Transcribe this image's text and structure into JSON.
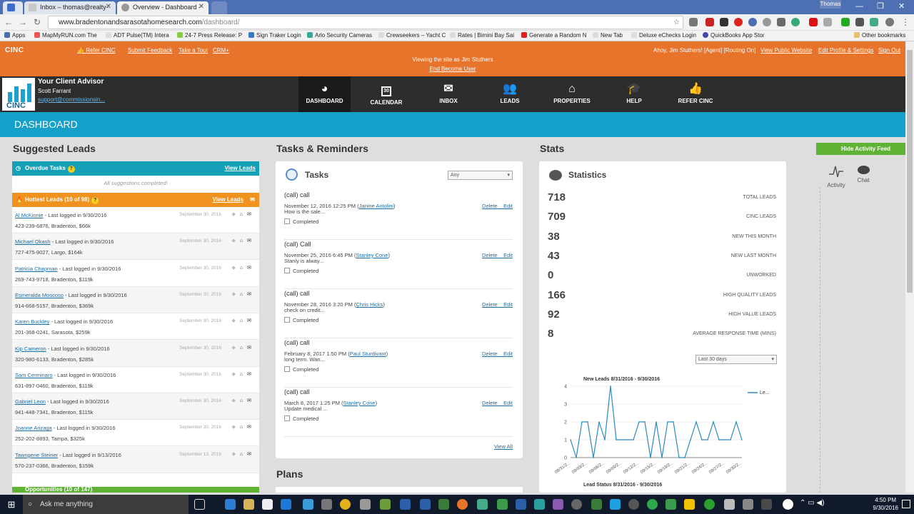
{
  "browser": {
    "tabs": [
      {
        "label": ""
      },
      {
        "label": "Inbox – thomas@realty-"
      },
      {
        "label": "Overview - Dashboard -"
      }
    ],
    "user": "Thomas",
    "url_main": "www.bradentonandsarasotahomesearch.com",
    "url_path": "/dashboard/",
    "bookmarks": [
      "Apps",
      "MapMyRUN.com The",
      "ADT Pulse(TM) Intera",
      "24-7 Press Release: P",
      "Sign Traker Login",
      "Arlo Security Cameras",
      "Crewseekers – Yacht C",
      "Rates | Bimini Bay Sai",
      "Generate a Random N",
      "New Tab",
      "Deluxe eChecks Login",
      "QuickBooks App Stor",
      "Other bookmarks"
    ]
  },
  "topbar": {
    "logo": "CINC",
    "links": [
      "Refer CINC",
      "Submit Feedback",
      "Take a Tour",
      "CRM+"
    ],
    "viewing": "Viewing the site as Jim Stuthers",
    "end_user": "End Become User",
    "greeting": "Ahoy, Jim Stuthers! [Agent] [Routing On]",
    "right_links": [
      "View Public Website",
      "Edit Profile & Settings",
      "Sign Out"
    ]
  },
  "advisor": {
    "title": "Your Client Advisor",
    "name": "Scott Farrant",
    "email": "support@commissionsin...",
    "logo_text": "CINC"
  },
  "nav": [
    {
      "label": "DASHBOARD",
      "icon": "dashboard-icon"
    },
    {
      "label": "CALENDAR",
      "icon": "calendar-icon",
      "day": "30"
    },
    {
      "label": "INBOX",
      "icon": "envelope-icon"
    },
    {
      "label": "LEADS",
      "icon": "users-icon"
    },
    {
      "label": "PROPERTIES",
      "icon": "home-icon"
    },
    {
      "label": "HELP",
      "icon": "graduation-cap-icon"
    },
    {
      "label": "REFER CINC",
      "icon": "thumbs-up-icon"
    }
  ],
  "page_title": "DASHBOARD",
  "suggested": {
    "title": "Suggested Leads",
    "overdue": "Overdue Tasks",
    "view_leads": "View Leads",
    "all_done": "All suggestions completed!",
    "hottest": "Hottest Leads (10 of 98)",
    "leads": [
      {
        "name": "Al McKinnie",
        "status": " - Last logged in 9/30/2016",
        "info": "423-239-6876, Bradenton, $66k",
        "date": "September 30, 2016"
      },
      {
        "name": "Michael Okash",
        "status": " - Last logged in 9/30/2016",
        "info": "727-475-9027, Largo, $164k",
        "date": "September 30, 2016"
      },
      {
        "name": "Patricia Chapman",
        "status": " - Last logged in 9/30/2016",
        "info": "269-743-9718, Bradenton, $119k",
        "date": "September 30, 2016"
      },
      {
        "name": "Esmeralda Moscoso",
        "status": " - Last logged in 9/30/2016",
        "info": "914-668-5157, Bradenton, $369k",
        "date": "September 30, 2016"
      },
      {
        "name": "Karen Buckley",
        "status": " - Last logged in 9/30/2016",
        "info": "201-368-0241, Sarasota, $259k",
        "date": "September 30, 2016"
      },
      {
        "name": "Kip Cameron",
        "status": " - Last logged in 9/30/2016",
        "info": "320-980-6133, Bradenton, $285k",
        "date": "September 30, 2016"
      },
      {
        "name": "Sam Cerminaro",
        "status": " - Last logged in 9/30/2016",
        "info": "631-897-0460, Bradenton, $119k",
        "date": "September 30, 2016"
      },
      {
        "name": "Gabriel Leon",
        "status": " - Last logged in 9/30/2016",
        "info": "941-448-7341, Bradenton, $115k",
        "date": "September 30, 2016"
      },
      {
        "name": "Joanne Arizaga",
        "status": " - Last logged in 9/30/2016",
        "info": "252-202-8893, Tampa, $325k",
        "date": "September 30, 2016"
      },
      {
        "name": "Tawngene Steiner",
        "status": " - Last logged in 9/13/2016",
        "info": "570-237-0366, Bradenton, $159k",
        "date": "September 13, 2016"
      }
    ],
    "opportunities": "Opportunities (10 of 147)"
  },
  "tasks": {
    "title": "Tasks & Reminders",
    "panel_title": "Tasks",
    "filter": "Any",
    "delete": "Delete",
    "edit": "Edit",
    "completed": "Completed",
    "items": [
      {
        "title": "(call) call",
        "when": "November 12, 2016 12:25 PM (",
        "who": "Janine Antolini",
        "note": "How is the sale..."
      },
      {
        "title": "(call) Call",
        "when": "November 25, 2016 6:45 PM (",
        "who": "Stanley Cone",
        "note": "Stanly is alway..."
      },
      {
        "title": "(call) call",
        "when": "November 28, 2016 3:20 PM (",
        "who": "Chris Hicks",
        "note": "check on credit..."
      },
      {
        "title": "(call) call",
        "when": "February 8, 2017 1:50 PM (",
        "who": "Paul Sturdivant",
        "note": "long term. Wan..."
      },
      {
        "title": "(call) call",
        "when": "March 8, 2017 1:25 PM (",
        "who": "Stanley Cone",
        "note": "Update medical ..."
      }
    ],
    "view_all": "View All",
    "plans": "Plans"
  },
  "stats": {
    "title": "Stats",
    "panel_title": "Statistics",
    "rows": [
      {
        "value": "718",
        "label": "TOTAL LEADS"
      },
      {
        "value": "709",
        "label": "CINC LEADS"
      },
      {
        "value": "38",
        "label": "NEW THIS MONTH"
      },
      {
        "value": "43",
        "label": "NEW LAST MONTH"
      },
      {
        "value": "0",
        "label": "UNWORKED"
      },
      {
        "value": "166",
        "label": "HIGH QUALITY LEADS"
      },
      {
        "value": "92",
        "label": "HIGH VALUE LEADS"
      },
      {
        "value": "8",
        "label": "AVERAGE RESPONSE TIME (MINS)"
      }
    ],
    "range": "Last 30 days",
    "lead_status": "Lead Status 8/31/2016 - 9/30/2016"
  },
  "chart_data": {
    "type": "line",
    "title": "New Leads 8/31/2016 - 9/30/2016",
    "legend": [
      "Le..."
    ],
    "legend_position": "top-right",
    "ylim": [
      0,
      4
    ],
    "yticks": [
      "0",
      "1",
      "2",
      "3",
      "4"
    ],
    "xticks": [
      "08/31/2...",
      "09/03/2...",
      "09/06/2...",
      "09/09/2...",
      "09/12/2...",
      "09/15/2...",
      "09/18/2...",
      "09/21/2...",
      "09/24/2...",
      "09/27/2...",
      "09/30/2..."
    ],
    "series": [
      {
        "name": "Le...",
        "color": "#2a8bc0",
        "values": [
          1,
          0,
          2,
          2,
          0,
          2,
          1,
          4,
          1,
          1,
          1,
          1,
          2,
          2,
          0,
          2,
          0,
          2,
          2,
          0,
          0,
          1,
          2,
          1,
          1,
          2,
          1,
          1,
          1,
          2,
          1
        ]
      }
    ]
  },
  "activity": {
    "hide": "Hide Activity Feed",
    "activity": "Activity",
    "chat": "Chat"
  },
  "taskbar": {
    "search": "Ask me anything",
    "time": "4:50 PM",
    "date": "9/30/2016"
  },
  "colors": {
    "orange": "#e8732b",
    "blue": "#14a0c9",
    "teal": "#14a0b6",
    "green": "#5fb234",
    "hot": "#f0921e"
  }
}
